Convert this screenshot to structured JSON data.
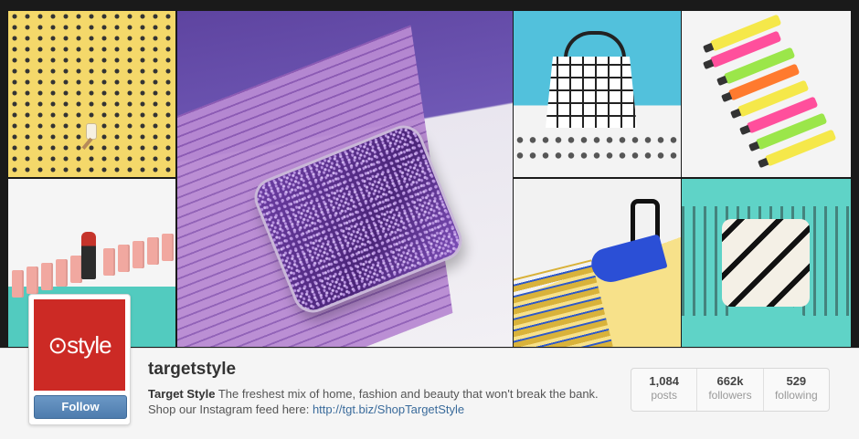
{
  "profile": {
    "avatar_text": "⊙style",
    "follow_label": "Follow",
    "username": "targetstyle",
    "bio_name": "Target Style",
    "bio_text": " The freshest mix of home, fashion and beauty that won't break the bank.",
    "bio_line2": "Shop our Instagram feed here: ",
    "bio_link": "http://tgt.biz/ShopTargetStyle"
  },
  "stats": [
    {
      "value": "1,084",
      "label": "posts"
    },
    {
      "value": "662k",
      "label": "followers"
    },
    {
      "value": "529",
      "label": "following"
    }
  ],
  "photos": [
    {
      "name": "nail-polish-photo"
    },
    {
      "name": "glitter-clutch-photo"
    },
    {
      "name": "grid-tote-photo"
    },
    {
      "name": "highlighters-photo"
    },
    {
      "name": "lipstick-photo"
    },
    {
      "name": "blue-heel-photo"
    },
    {
      "name": "chevron-pillow-photo"
    }
  ],
  "colors": {
    "brand_red": "#cc2a25",
    "follow_blue": "#5a88b8",
    "link_blue": "#3a6b9b"
  }
}
